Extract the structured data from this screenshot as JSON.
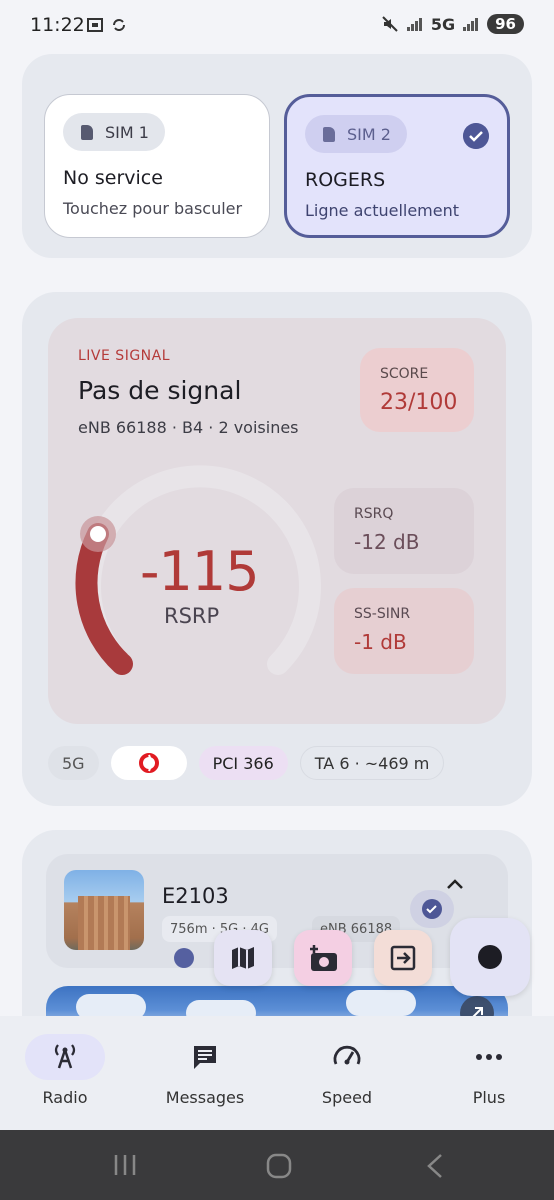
{
  "status_bar": {
    "time": "11:22",
    "network": "5G",
    "battery": "96"
  },
  "sims": {
    "sim1": {
      "label": "SIM 1",
      "title": "No service",
      "subtitle": "Touchez pour basculer"
    },
    "sim2": {
      "label": "SIM 2",
      "title": "ROGERS",
      "subtitle": "Ligne actuellement",
      "active": true
    }
  },
  "signal": {
    "live_label": "LIVE SIGNAL",
    "title": "Pas de signal",
    "subtitle": "eNB 66188 · B4 · 2 voisines",
    "score_label": "SCORE",
    "score_value": "23/100",
    "rsrp_value": "-115",
    "rsrp_label": "RSRP",
    "rsrq_label": "RSRQ",
    "rsrq_value": "-12 dB",
    "sinr_label": "SS-SINR",
    "sinr_value": "-1 dB",
    "chips": [
      "5G",
      "PCI 366",
      "TA 6 · ~469 m"
    ]
  },
  "cell": {
    "name": "E2103",
    "tag1": "756m · 5G · 4G",
    "tag2": "eNB 66188"
  },
  "nav": {
    "items": [
      {
        "label": "Radio"
      },
      {
        "label": "Messages"
      },
      {
        "label": "Speed"
      },
      {
        "label": "Plus"
      }
    ]
  },
  "colors": {
    "accent": "#4e5796",
    "signal_red": "#b03a38"
  }
}
